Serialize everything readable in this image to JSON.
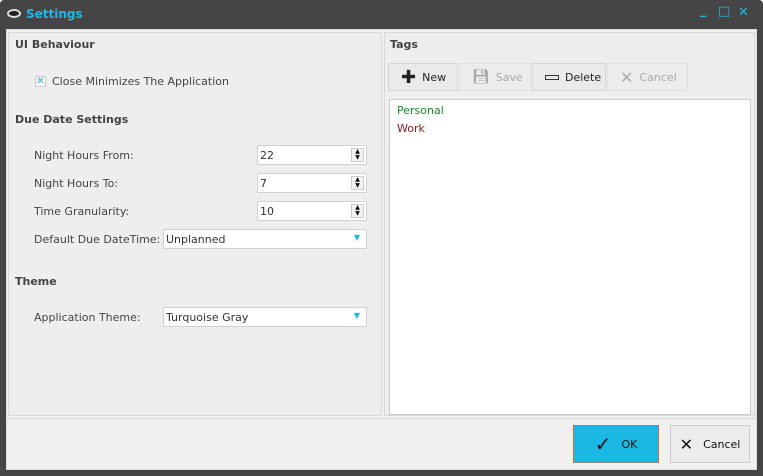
{
  "window": {
    "title": "Settings",
    "minimize": "_",
    "maximize": "□",
    "close": "✕"
  },
  "left": {
    "ui_behaviour": {
      "heading": "UI Behaviour",
      "close_minimizes": {
        "label": "Close Minimizes The Application",
        "checked": true,
        "mark": "✕"
      }
    },
    "due_date": {
      "heading": "Due Date Settings",
      "night_from": {
        "label": "Night Hours From:",
        "value": "22"
      },
      "night_to": {
        "label": "Night Hours To:",
        "value": "7"
      },
      "granularity": {
        "label": "Time Granularity:",
        "value": "10"
      },
      "default_due": {
        "label": "Default Due DateTime:",
        "value": "Unplanned"
      }
    },
    "theme": {
      "heading": "Theme",
      "app_theme": {
        "label": "Application Theme:",
        "value": "Turquoise Gray"
      }
    }
  },
  "tags": {
    "heading": "Tags",
    "toolbar": {
      "new": "New",
      "save": "Save",
      "delete": "Delete",
      "cancel": "Cancel"
    },
    "items": [
      {
        "label": "Personal",
        "color": "#1a8a2a"
      },
      {
        "label": "Work",
        "color": "#8b1a1a"
      }
    ]
  },
  "footer": {
    "ok": "OK",
    "cancel": "Cancel"
  },
  "colors": {
    "accent": "#1fb8e6"
  }
}
